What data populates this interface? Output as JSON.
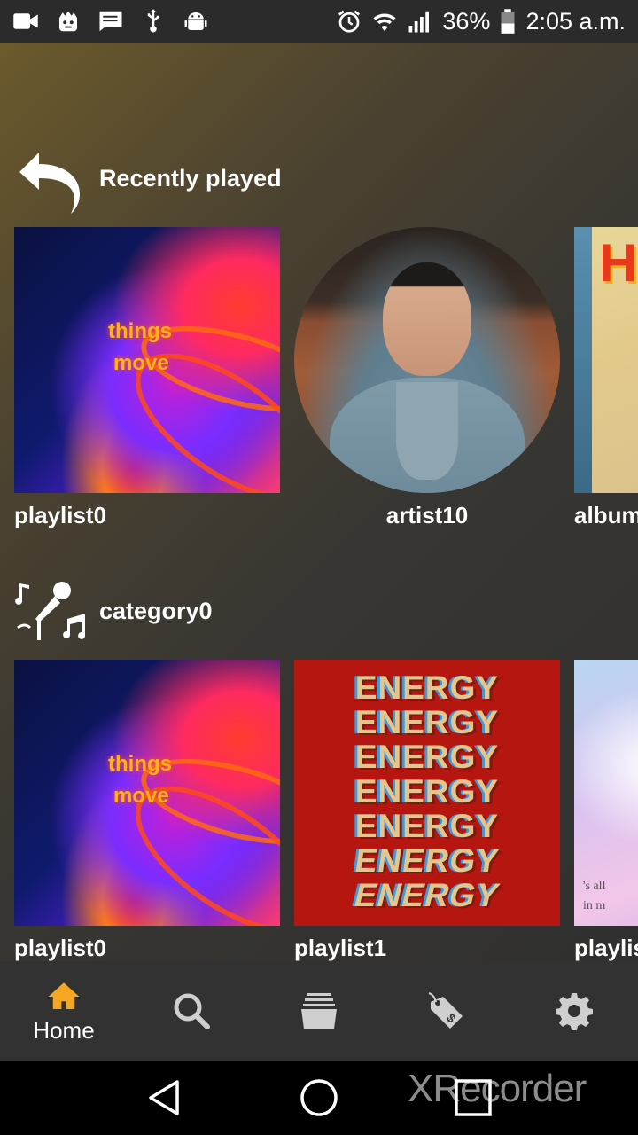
{
  "status_bar": {
    "left_icons": [
      "video-camera-icon",
      "face-icon",
      "message-icon",
      "usb-icon",
      "android-icon"
    ],
    "right_icons": [
      "alarm-icon",
      "wifi-icon",
      "signal-icon",
      "battery-icon"
    ],
    "battery": "36%",
    "time": "2:05 a.m."
  },
  "sections": [
    {
      "title": "Recently played",
      "icon": "history-undo-icon",
      "items": [
        {
          "label": "playlist0",
          "art": "things-move-artwork"
        },
        {
          "label": "artist10",
          "art": "artist-portrait"
        },
        {
          "label": "album",
          "art": "album-artwork"
        }
      ]
    },
    {
      "title": "category0",
      "icon": "music-microphone-icon",
      "items": [
        {
          "label": "playlist0",
          "art": "things-move-artwork"
        },
        {
          "label": "playlist1",
          "art": "energy-artwork"
        },
        {
          "label": "playlis",
          "art": "pastel-artwork"
        }
      ]
    }
  ],
  "artwork_text": {
    "things_line1": "things",
    "things_line2": "move",
    "energy_word": "ENERGY",
    "album_word": "H",
    "pastel_line1": "'s all",
    "pastel_line2": "in m"
  },
  "bottom_nav": {
    "items": [
      {
        "label": "Home",
        "icon": "home-icon",
        "active": true
      },
      {
        "label": "",
        "icon": "search-icon"
      },
      {
        "label": "",
        "icon": "library-stack-icon"
      },
      {
        "label": "",
        "icon": "price-tag-icon"
      },
      {
        "label": "",
        "icon": "settings-gear-icon"
      }
    ],
    "active_color": "#f5a623"
  },
  "system_nav": {
    "buttons": [
      "back-icon",
      "home-circle-icon",
      "recents-square-icon"
    ],
    "watermark": "XRecorder"
  }
}
